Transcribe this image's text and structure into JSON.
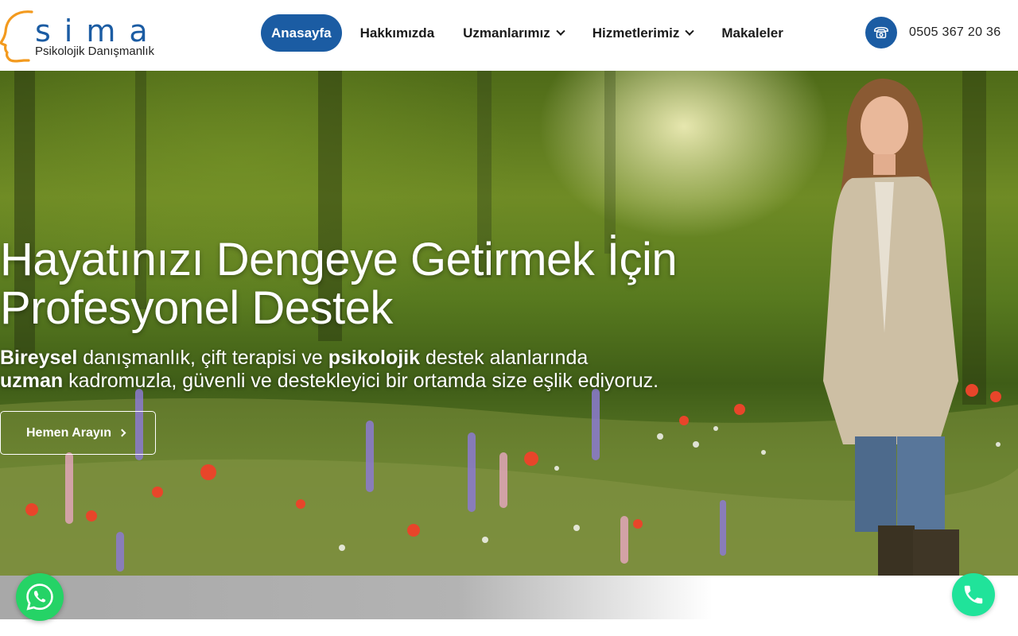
{
  "brand": {
    "name": "sima",
    "tagline": "Psikolojik Danışmanlık",
    "primary_color": "#1b5ca3",
    "accent_color": "#f39a1e"
  },
  "nav": {
    "items": [
      {
        "label": "Anasayfa",
        "active": true,
        "dropdown": false
      },
      {
        "label": "Hakkımızda",
        "active": false,
        "dropdown": false
      },
      {
        "label": "Uzmanlarımız",
        "active": false,
        "dropdown": true
      },
      {
        "label": "Hizmetlerimiz",
        "active": false,
        "dropdown": true
      },
      {
        "label": "Makaleler",
        "active": false,
        "dropdown": false
      }
    ]
  },
  "contact": {
    "phone": "0505 367 20 36",
    "icon": "telephone-icon"
  },
  "hero": {
    "title_line1": "Hayatınızı Dengeye Getirmek İçin",
    "title_line2": "Profesyonel Destek",
    "desc_line1_bold1": "Bireysel",
    "desc_line1_text1": " danışmanlık, çift terapisi ve ",
    "desc_line1_bold2": "psikolojik",
    "desc_line1_text2": " destek alanlarında",
    "desc_line2_bold": "uzman",
    "desc_line2_text": " kadromuzla, güvenli ve destekleyici bir ortamda size eşlik ediyoruz.",
    "cta_label": "Hemen Arayın",
    "cta_icon": "chevron-right-icon"
  },
  "floating": {
    "whatsapp_icon": "whatsapp-icon",
    "whatsapp_color": "#25d366",
    "call_icon": "phone-icon",
    "call_color": "#20e39a"
  }
}
